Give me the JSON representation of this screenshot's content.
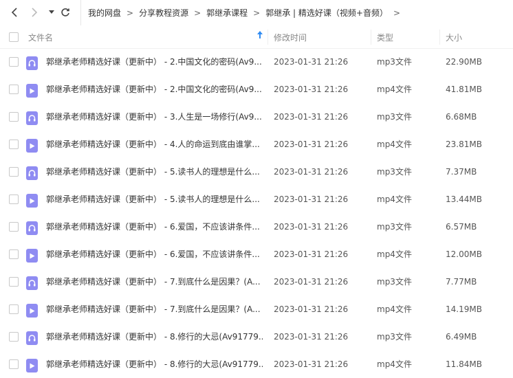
{
  "breadcrumb": [
    "我的网盘",
    "分享教程资源",
    "郭继承课程",
    "郭继承 | 精选好课（视频+音频）"
  ],
  "breadcrumb_separator": ">",
  "columns": {
    "name": "文件名",
    "mtime": "修改时间",
    "type": "类型",
    "size": "大小"
  },
  "sort": {
    "column": "name",
    "direction": "ascending"
  },
  "colors": {
    "file_icon": "#8f8cf2",
    "sort_indicator": "#2f8bf2"
  },
  "files": [
    {
      "name": "郭继承老师精选好课（更新中） - 2.中国文化的密码(Av9...",
      "mtime": "2023-01-31 21:26",
      "type": "mp3文件",
      "size": "22.90MB",
      "icon": "audio-file-icon"
    },
    {
      "name": "郭继承老师精选好课（更新中） - 2.中国文化的密码(Av9...",
      "mtime": "2023-01-31 21:26",
      "type": "mp4文件",
      "size": "41.81MB",
      "icon": "video-file-icon"
    },
    {
      "name": "郭继承老师精选好课（更新中） - 3.人生是一场修行(Av9...",
      "mtime": "2023-01-31 21:26",
      "type": "mp3文件",
      "size": "6.68MB",
      "icon": "audio-file-icon"
    },
    {
      "name": "郭继承老师精选好课（更新中） - 4.人的命运到底由谁掌...",
      "mtime": "2023-01-31 21:26",
      "type": "mp4文件",
      "size": "23.81MB",
      "icon": "video-file-icon"
    },
    {
      "name": "郭继承老师精选好课（更新中） - 5.读书人的理想是什么...",
      "mtime": "2023-01-31 21:26",
      "type": "mp3文件",
      "size": "7.37MB",
      "icon": "audio-file-icon"
    },
    {
      "name": "郭继承老师精选好课（更新中） - 5.读书人的理想是什么...",
      "mtime": "2023-01-31 21:26",
      "type": "mp4文件",
      "size": "13.44MB",
      "icon": "video-file-icon"
    },
    {
      "name": "郭继承老师精选好课（更新中） - 6.爱国，不应该讲条件...",
      "mtime": "2023-01-31 21:26",
      "type": "mp3文件",
      "size": "6.57MB",
      "icon": "audio-file-icon"
    },
    {
      "name": "郭继承老师精选好课（更新中） - 6.爱国，不应该讲条件...",
      "mtime": "2023-01-31 21:26",
      "type": "mp4文件",
      "size": "12.00MB",
      "icon": "video-file-icon"
    },
    {
      "name": "郭继承老师精选好课（更新中） - 7.到底什么是因果？(A...",
      "mtime": "2023-01-31 21:26",
      "type": "mp3文件",
      "size": "7.77MB",
      "icon": "audio-file-icon"
    },
    {
      "name": "郭继承老师精选好课（更新中） - 7.到底什么是因果？(A...",
      "mtime": "2023-01-31 21:26",
      "type": "mp4文件",
      "size": "14.19MB",
      "icon": "video-file-icon"
    },
    {
      "name": "郭继承老师精选好课（更新中） - 8.修行的大忌(Av91779...",
      "mtime": "2023-01-31 21:26",
      "type": "mp3文件",
      "size": "6.49MB",
      "icon": "audio-file-icon"
    },
    {
      "name": "郭继承老师精选好课（更新中） - 8.修行的大忌(Av91779...",
      "mtime": "2023-01-31 21:26",
      "type": "mp4文件",
      "size": "11.84MB",
      "icon": "video-file-icon"
    }
  ]
}
